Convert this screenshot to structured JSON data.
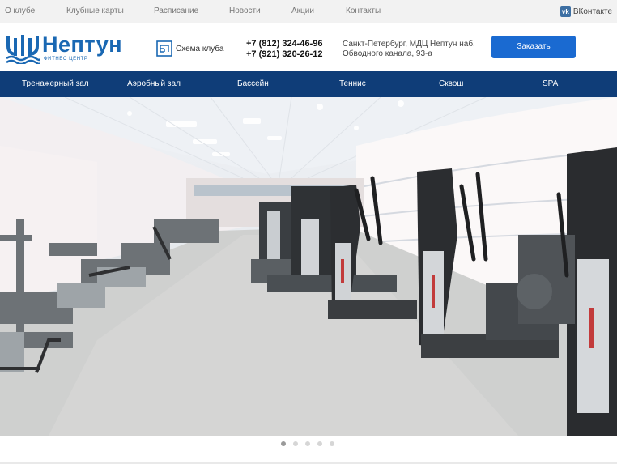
{
  "topbar": {
    "links": [
      "О клубе",
      "Клубные карты",
      "Расписание",
      "Новости",
      "Акции",
      "Контакты"
    ],
    "vk_label": "ВКонтакте"
  },
  "header": {
    "brand": "Нептун",
    "tagline": "фитнес центр",
    "scheme_label": "Схема клуба",
    "phone1": "+7 (812) 324-46-96",
    "phone2": "+7 (921) 320-26-12",
    "address_line1": "Санкт-Петербург, МДЦ Нептун наб.",
    "address_line2": "Обводного канала, 93-а",
    "order_label": "Заказать"
  },
  "nav": {
    "items": [
      "Тренажерный зал",
      "Аэробный зал",
      "Бассейн",
      "Теннис",
      "Сквош",
      "SPA"
    ]
  },
  "slider": {
    "slide_count": 5,
    "active_index": 0
  },
  "colors": {
    "brand_blue": "#1a68b3",
    "nav_bg": "#0f3d78",
    "button_bg": "#1a6ad1",
    "topbar_bg": "#f2f2f2"
  }
}
